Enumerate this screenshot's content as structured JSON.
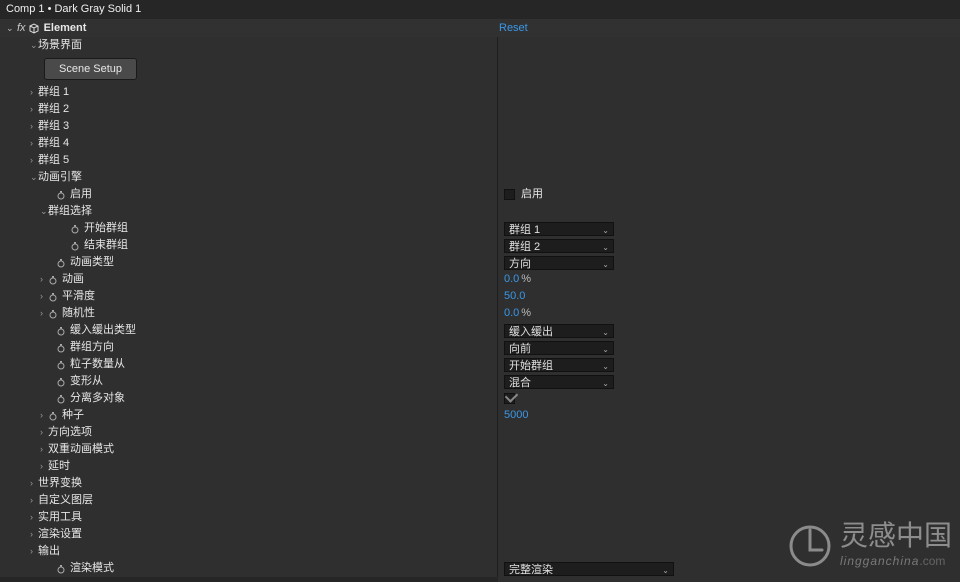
{
  "header": {
    "title": "Comp 1 • Dark Gray Solid 1"
  },
  "effect": {
    "fx_label": "fx",
    "name": "Element",
    "reset": "Reset"
  },
  "scene": {
    "label": "场景界面",
    "setup_btn": "Scene Setup"
  },
  "groups": [
    "群组 1",
    "群组 2",
    "群组 3",
    "群组 4",
    "群组 5"
  ],
  "anim_engine": {
    "label": "动画引擎",
    "enable_label": "启用",
    "group_select": {
      "label": "群组选择",
      "start_label": "开始群组",
      "start_value": "群组 1",
      "end_label": "结束群组",
      "end_value": "群组 2"
    },
    "anim_type": {
      "label": "动画类型",
      "value": "方向"
    },
    "animation": {
      "label": "动画",
      "value": "0.0",
      "unit": "%"
    },
    "smoothness": {
      "label": "平滑度",
      "value": "50.0"
    },
    "randomness": {
      "label": "随机性",
      "value": "0.0",
      "unit": "%"
    },
    "ease": {
      "label": "缓入缓出类型",
      "value": "缓入缓出"
    },
    "group_dir": {
      "label": "群组方向",
      "value": "向前"
    },
    "particle_from": {
      "label": "粒子数量从",
      "value": "开始群组"
    },
    "morph_from": {
      "label": "变形从",
      "value": "混合"
    },
    "separate_multi": {
      "label": "分离多对象",
      "checked": true
    },
    "seed": {
      "label": "种子",
      "value": "5000"
    },
    "direction_opts": "方向选项",
    "double_anim": "双重动画模式",
    "delay": "延时"
  },
  "sections": {
    "world_xform": "世界变换",
    "custom_layers": "自定义图层",
    "utilities": "实用工具",
    "render_settings": "渲染设置",
    "output": "输出"
  },
  "render_mode": {
    "label": "渲染模式",
    "value": "完整渲染"
  },
  "watermark": {
    "brand_cn": "灵感中国",
    "brand_en": "lingganchina",
    "tld": ".com"
  }
}
